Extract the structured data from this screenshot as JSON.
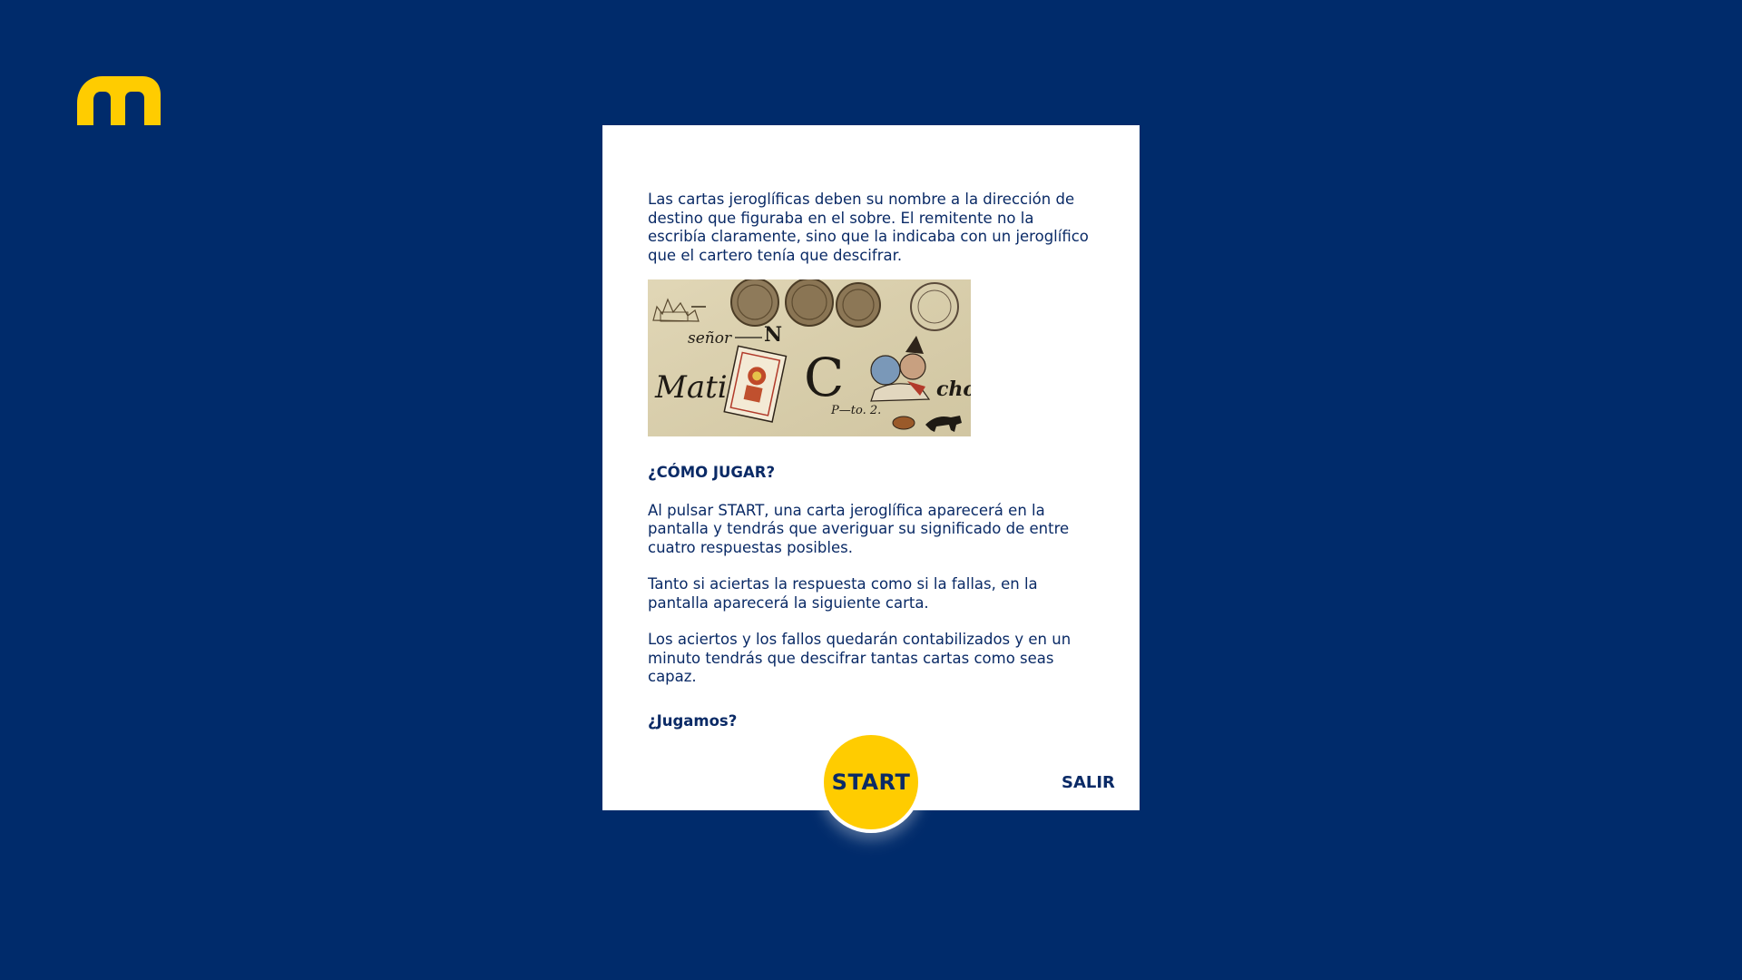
{
  "brand": {
    "logo_icon": "m-logo-icon",
    "logo_color": "#ffcc00",
    "background_color": "#002b6b"
  },
  "card": {
    "intro": "Las cartas jeroglíficas deben su nombre a la dirección de destino que figuraba en el sobre. El remitente no la escribía claramente, sino que la indicaba con un jeroglífico que el cartero tenía que descifrar.",
    "image_icon": "hieroglyphic-letter-image",
    "image_text": {
      "line1": "señor",
      "n": "N",
      "mati": "Mati",
      "c": "C",
      "cho": "cho",
      "puerto": "P—to. 2."
    },
    "how_to_heading": "¿CÓMO JUGAR?",
    "paragraph1": "Al pulsar START, una carta jeroglífica aparecerá en la pantalla y tendrás que averiguar su significado de entre cuatro respuestas posibles.",
    "paragraph2": "Tanto si aciertas la respuesta como si la fallas, en la pantalla aparecerá la siguiente carta.",
    "paragraph3": "Los aciertos y los fallos quedarán contabilizados y en un minuto tendrás que descifrar tantas cartas como seas capaz.",
    "closing": "¿Jugamos?"
  },
  "buttons": {
    "start_label": "START",
    "start_color": "#ffcc00",
    "salir_label": "SALIR"
  }
}
